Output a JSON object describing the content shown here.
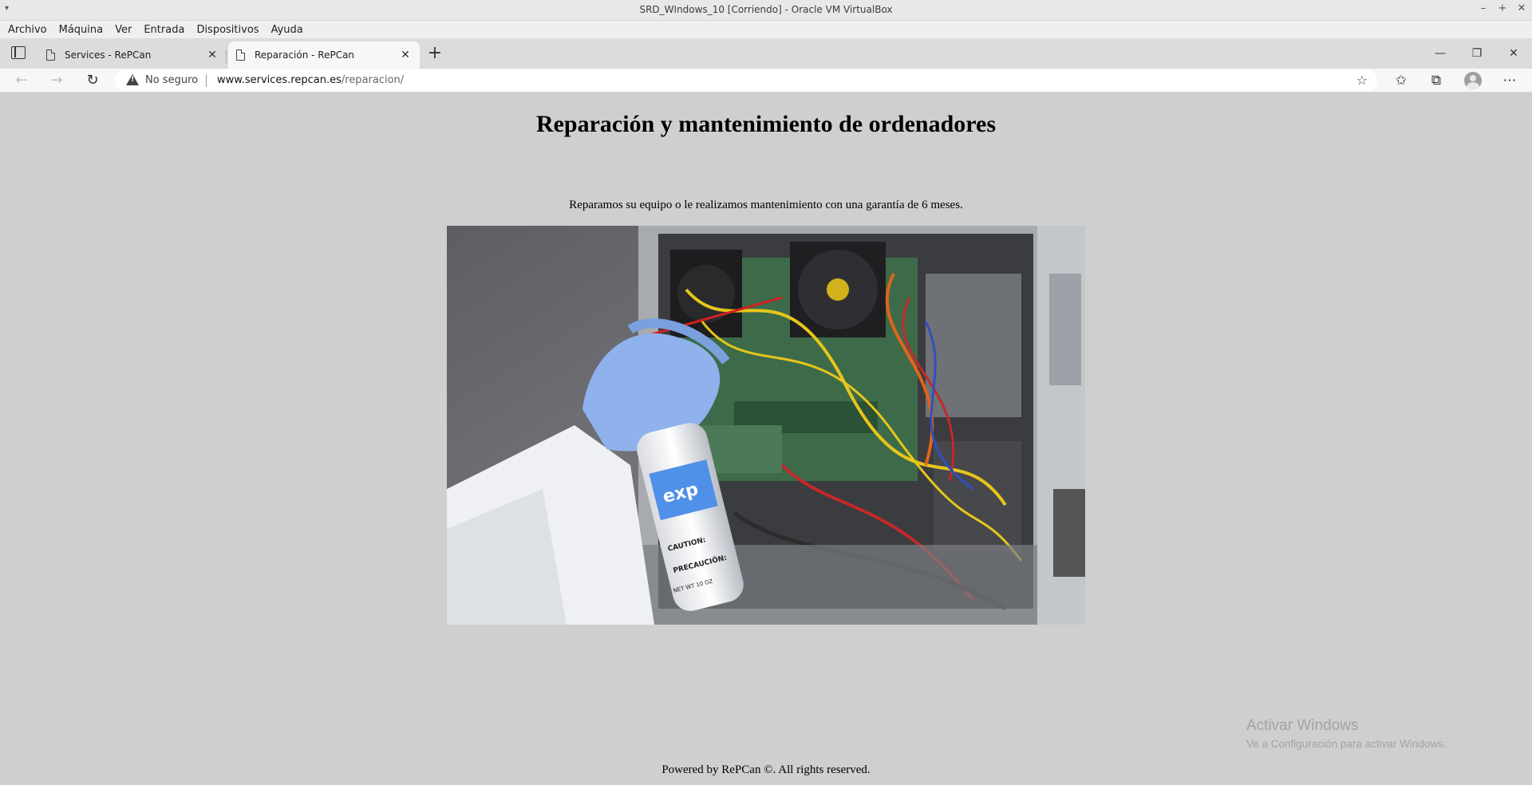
{
  "vm": {
    "title": "SRD_WIndows_10 [Corriendo] - Oracle VM VirtualBox",
    "menu": [
      "Archivo",
      "Máquina",
      "Ver",
      "Entrada",
      "Dispositivos",
      "Ayuda"
    ]
  },
  "browser": {
    "tabs": [
      {
        "label": "Services - RePCan",
        "active": false
      },
      {
        "label": "Reparación - RePCan",
        "active": true
      }
    ],
    "security_label": "No seguro",
    "url_host": "www.services.repcan.es",
    "url_path": "/reparacion/"
  },
  "page": {
    "title": "Reparación y mantenimiento de ordenadores",
    "description": "Reparamos su equipo o le realizamos mantenimiento con una garantía de 6 meses.",
    "photo": {
      "can_brand": "exp",
      "can_caution": "CAUTION:",
      "can_precaution": "PRECAUCIÓN:",
      "can_weight": "NET WT 10 OZ"
    },
    "footer": "Powered by RePCan ©. All rights reserved."
  },
  "watermark": {
    "title": "Activar Windows",
    "subtitle": "Ve a Configuración para activar Windows."
  }
}
